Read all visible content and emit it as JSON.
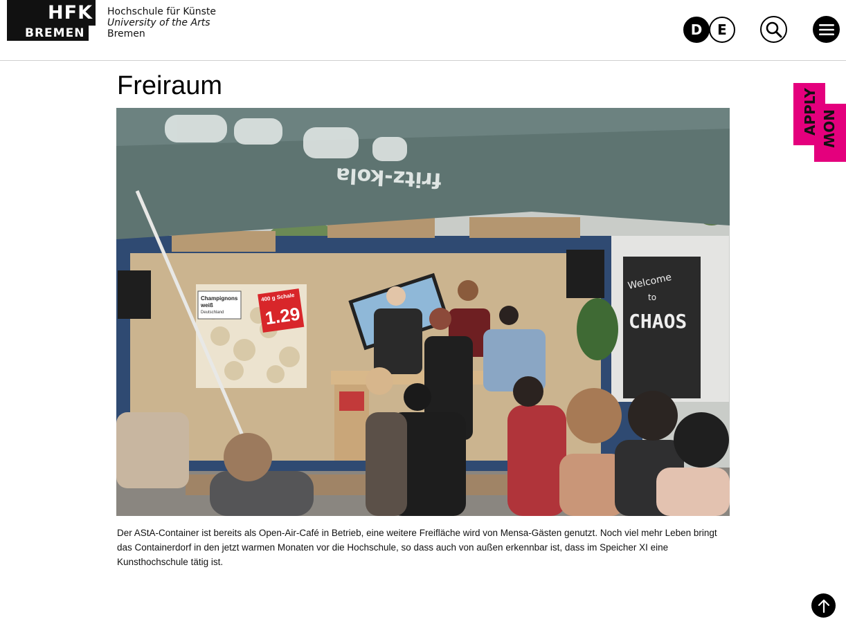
{
  "header": {
    "logo": {
      "mark_line1": "HFK",
      "mark_line2": "BREMEN",
      "text_line1": "Hochschule für Künste",
      "text_line2": "University of the Arts",
      "text_line3": "Bremen"
    },
    "languages": [
      "D",
      "E"
    ],
    "icons": {
      "search": "search-icon",
      "menu": "hamburger-menu-icon"
    }
  },
  "apply_now": {
    "line1": "APPLY",
    "line2": "NOW",
    "color": "#e4007d"
  },
  "main": {
    "title": "Freiraum",
    "photo": {
      "sign_champignons": "Champignons",
      "sign_weiss": "weiß",
      "sign_origin": "Deutschland",
      "price_tag_label": "400 g Schale",
      "price_tag_price": "1.29",
      "chalkboard_line1": "Welcome",
      "chalkboard_line2": "to",
      "chalkboard_line3": "CHAOS",
      "umbrella_print": "fritz-kola"
    },
    "caption": "Der AStA-Container ist bereits als Open-Air-Café in Betrieb, eine weitere Freifläche wird von Mensa-Gästen genutzt. Noch viel mehr Leben bringt das Containerdorf in den jetzt warmen Monaten vor die Hochschule, so dass auch von außen erkennbar ist, dass im Speicher XI eine Kunsthochschule tätig ist."
  },
  "back_to_top": {
    "icon": "arrow-up-icon"
  },
  "colors": {
    "accent": "#e4007d",
    "text": "#000000",
    "border": "#cfcfcf"
  }
}
